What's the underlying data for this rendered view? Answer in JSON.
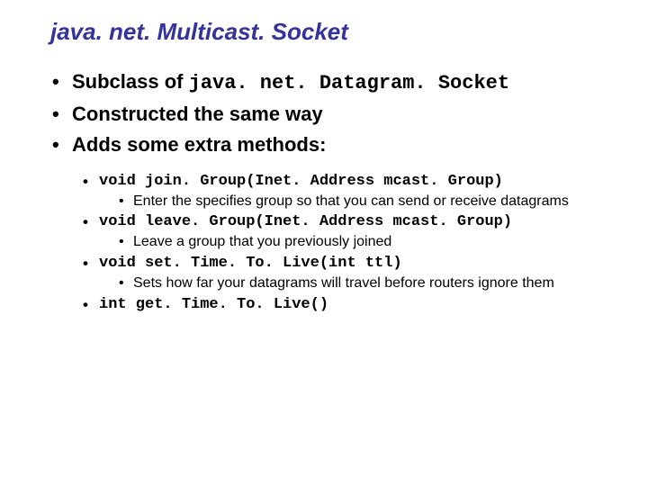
{
  "title": "java. net. Multicast. Socket",
  "bullets": {
    "b1_prefix": "Subclass of ",
    "b1_code": "java. net. Datagram. Socket",
    "b2": "Constructed the same way",
    "b3": "Adds some extra methods:"
  },
  "methods": {
    "m1": "void join. Group(Inet. Address mcast. Group)",
    "m1_desc": "Enter the specifies group so that you can send or receive datagrams",
    "m2": "void leave. Group(Inet. Address mcast. Group)",
    "m2_desc": "Leave a group that you previously joined",
    "m3": "void set. Time. To. Live(int ttl)",
    "m3_desc": "Sets how far your datagrams will travel before routers ignore them",
    "m4": "int get. Time. To. Live()"
  }
}
